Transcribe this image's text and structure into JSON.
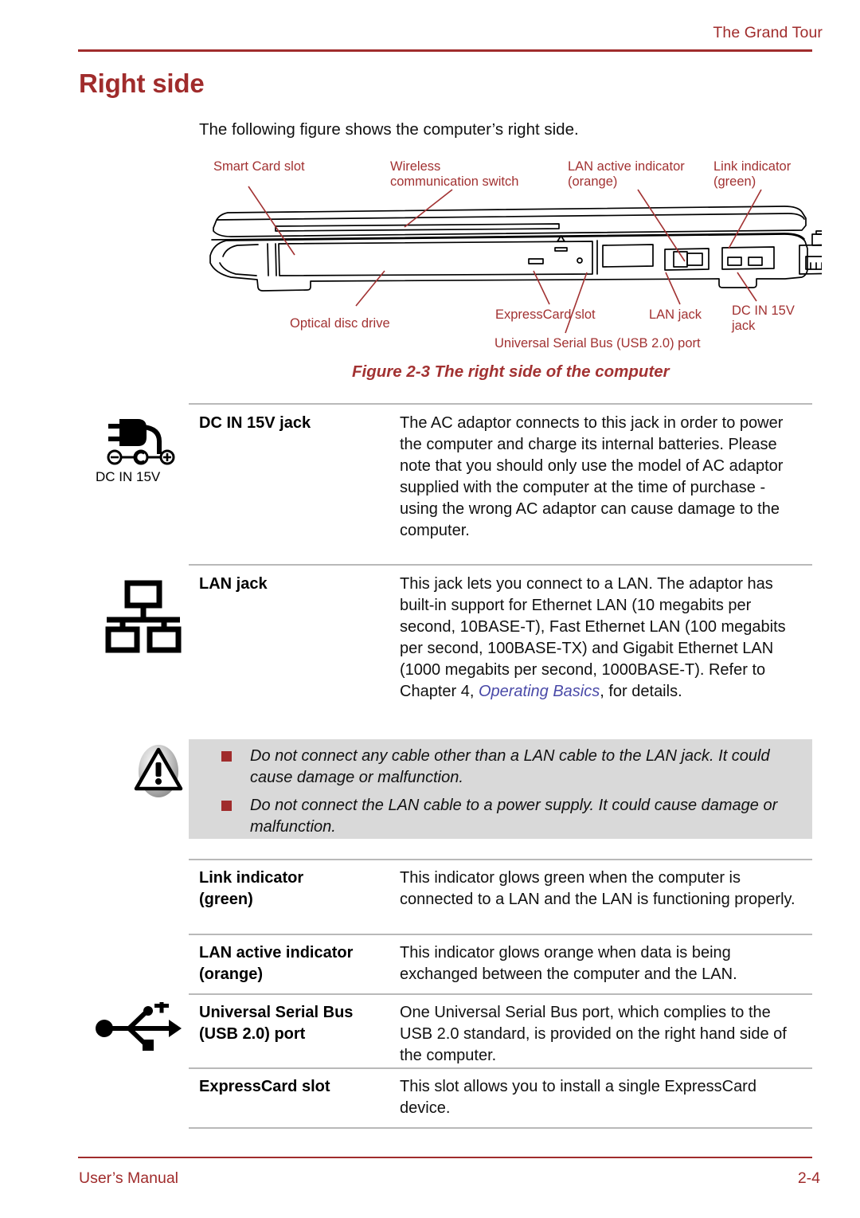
{
  "header": {
    "chapter_title": "The Grand Tour"
  },
  "page_title": "Right side",
  "intro": "The following figure shows the computer’s right side.",
  "figure": {
    "caption": "Figure 2-3 The right side of the computer",
    "callouts": [
      {
        "id": "smart-card-slot",
        "label": "Smart Card slot"
      },
      {
        "id": "wireless-communication-switch",
        "label": "Wireless\ncommunication switch"
      },
      {
        "id": "lan-active-indicator",
        "label": "LAN active indicator\n(orange)"
      },
      {
        "id": "link-indicator",
        "label": "Link indicator\n(green)"
      },
      {
        "id": "optical-disc-drive",
        "label": "Optical disc drive"
      },
      {
        "id": "expresscard-slot",
        "label": "ExpressCard slot"
      },
      {
        "id": "usb-port",
        "label": "Universal Serial Bus (USB 2.0) port"
      },
      {
        "id": "lan-jack",
        "label": "LAN jack"
      },
      {
        "id": "dc-in-jack",
        "label": "DC IN 15V\njack"
      }
    ]
  },
  "icons": {
    "dc_in_caption": "DC IN 15V"
  },
  "entries": [
    {
      "term": "DC IN 15V jack",
      "description": "The AC adaptor connects to this jack in order to power the computer and charge its internal batteries. Please note that you should only use the model of AC adaptor supplied with the computer at the time of purchase - using the wrong AC adaptor can cause damage to the computer."
    },
    {
      "term": "LAN jack",
      "description_pre": "This jack lets you connect to a LAN. The adaptor has built-in support for Ethernet LAN (10 megabits per second, 10BASE-T), Fast Ethernet LAN (100 megabits per second, 100BASE-TX) and Gigabit Ethernet LAN (1000 megabits per second, 1000BASE-T). Refer to Chapter 4, ",
      "description_link": "Operating Basics",
      "description_post": ", for details."
    },
    {
      "term": "Link indicator\n(green)",
      "description": "This indicator glows green when the computer is connected to a LAN and the LAN is functioning properly."
    },
    {
      "term": "LAN active indicator\n(orange)",
      "description": "This indicator glows orange when data is being exchanged between the computer and the LAN."
    },
    {
      "term": "Universal Serial Bus\n(USB 2.0) port",
      "description": "One Universal Serial Bus port, which complies to the USB 2.0 standard, is provided on the right hand side of the computer."
    },
    {
      "term": "ExpressCard slot",
      "description": "This slot allows you to install a single ExpressCard device."
    }
  ],
  "caution": {
    "items": [
      "Do not connect any cable other than a LAN cable to the LAN jack. It could cause damage or malfunction.",
      "Do not connect the LAN cable to a power supply. It could cause damage or malfunction."
    ]
  },
  "footer": {
    "left": "User’s Manual",
    "right": "2-4"
  },
  "colors": {
    "brand_red": "#A02C2C",
    "callout_red": "#A23232",
    "link_blue": "#4A4AA8",
    "caution_bg": "#d9d9d9"
  }
}
